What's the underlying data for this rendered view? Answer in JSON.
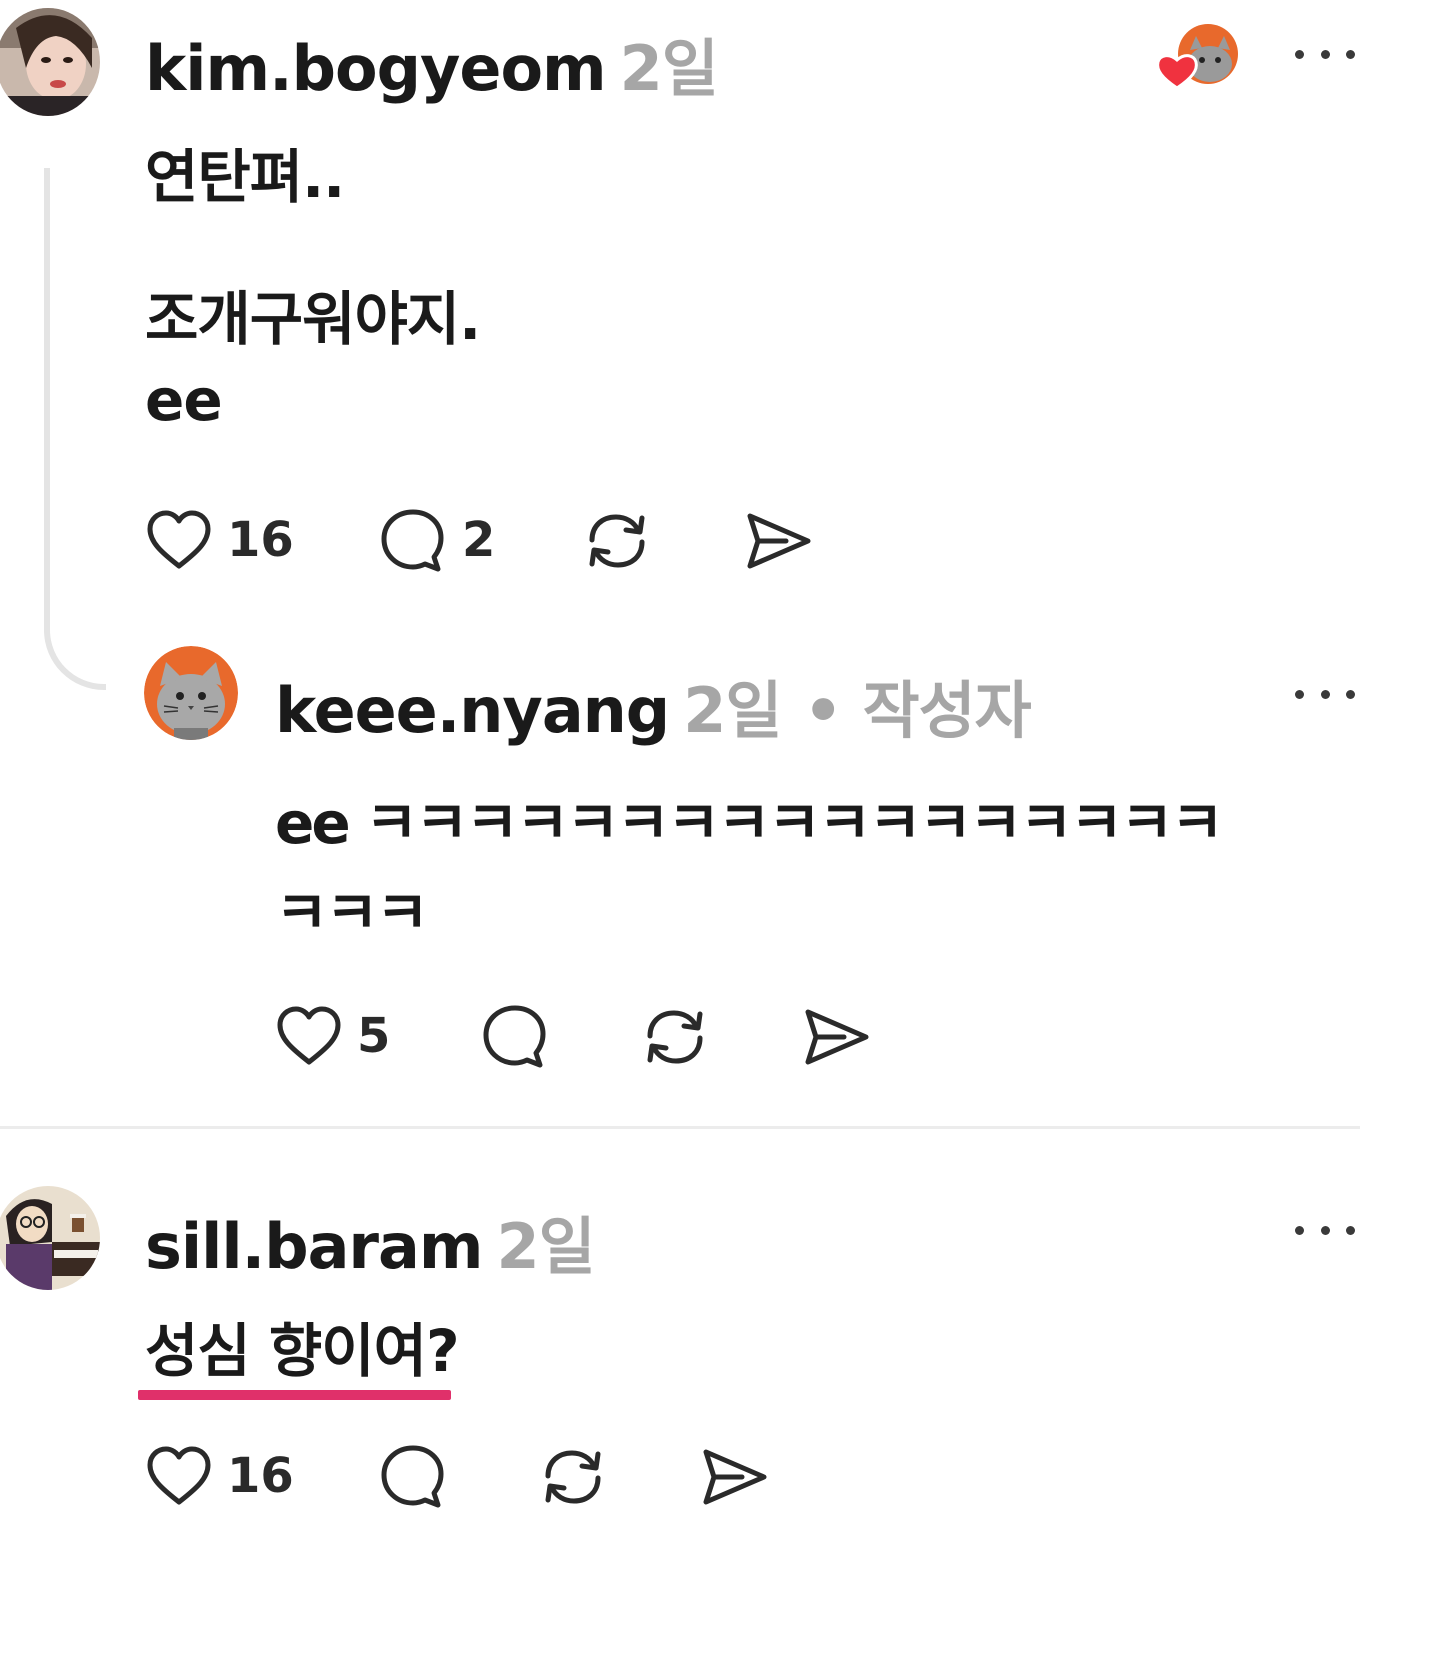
{
  "post1": {
    "username": "kim.bogyeom",
    "time": "2일",
    "lines": [
      "연탄펴..",
      "조개구워야지.",
      "ee"
    ],
    "likes": "16",
    "comments": "2",
    "icons": {
      "like": "heart-icon",
      "comment": "comment-icon",
      "repost": "repost-icon",
      "share": "send-icon",
      "more": "more-icon",
      "liked_by": "liked-by-author-icon"
    }
  },
  "reply1": {
    "username": "keee.nyang",
    "time": "2일",
    "author_badge": "• 작성자",
    "lines": [
      "ee ㅋㅋㅋㅋㅋㅋㅋㅋㅋㅋㅋㅋㅋㅋㅋㅋㅋ",
      "ㅋㅋㅋ"
    ],
    "likes": "5"
  },
  "post2": {
    "username": "sill.baram",
    "time": "2일",
    "lines": [
      "성심 향이여?"
    ],
    "likes": "16"
  },
  "colors": {
    "text": "#1a1a1a",
    "meta": "#a6a6a6",
    "heart": "#f0323f",
    "underline": "#e0306a",
    "avatar_orange": "#e8692c"
  }
}
